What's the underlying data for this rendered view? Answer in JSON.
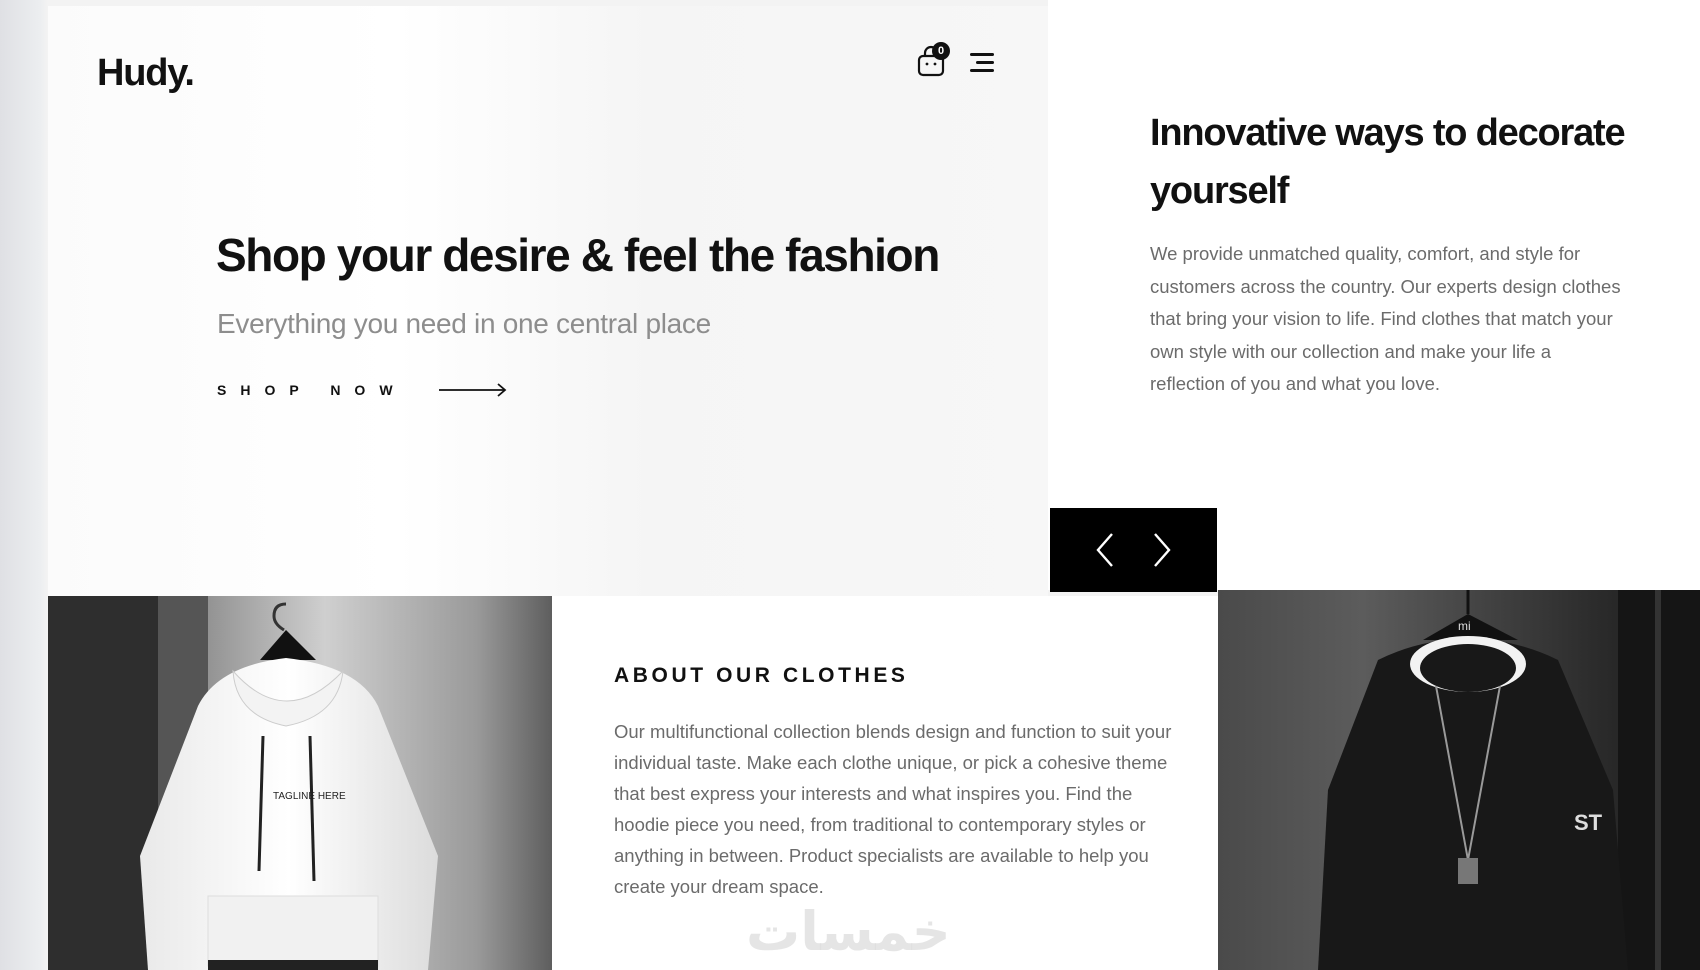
{
  "header": {
    "logo": "Hudy.",
    "cart_count": "0",
    "cart_icon": "shopping-bag-icon",
    "menu_icon": "hamburger-menu-icon"
  },
  "hero": {
    "title": "Shop your desire & feel the fashion",
    "subtitle": "Everything you need in one central place",
    "cta_label": "SHOP NOW",
    "cta_icon": "long-arrow-right-icon"
  },
  "side": {
    "title": "Innovative ways to decorate yourself",
    "text": "We provide unmatched quality, comfort, and style for customers across the country. Our experts design clothes that bring your vision to life. Find clothes that match your own style with our collection and make your life a reflection of you and what you love."
  },
  "slider": {
    "prev_icon": "chevron-left-icon",
    "next_icon": "chevron-right-icon"
  },
  "about": {
    "title": "ABOUT OUR CLOTHES",
    "text": "Our multifunctional collection blends design and function to suit your individual taste. Make each clothe unique, or pick a cohesive theme that best express your interests and what inspires you. Find the hoodie piece you need, from traditional to contemporary styles or anything in between. Product specialists are available to help you create your dream space."
  },
  "products": {
    "hoodie_print": "TAGLINE HERE",
    "sweater_logo": "mi",
    "sweater_sleeve": "ST"
  },
  "watermark": "خمسات",
  "colors": {
    "text": "#111111",
    "muted": "#6b6b6b",
    "subtitle": "#8d8d8d",
    "control_bg": "#000000"
  }
}
